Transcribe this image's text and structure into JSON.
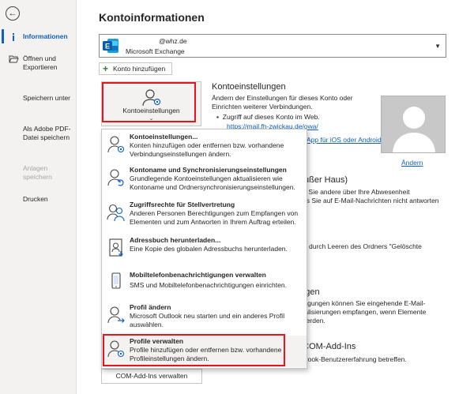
{
  "sidebar": {
    "back_icon": "arrow-left-icon",
    "items": [
      {
        "label": "Informationen",
        "icon": "info-icon"
      },
      {
        "label": "Öffnen und Exportieren",
        "icon": "folder-open-icon"
      },
      {
        "label": "Speichern unter"
      },
      {
        "label": "Als Adobe PDF-Datei speichern"
      },
      {
        "label": "Anlagen speichern"
      },
      {
        "label": "Drucken"
      }
    ]
  },
  "main": {
    "title": "Kontoinformationen",
    "account": {
      "email": "@whz.de",
      "type": "Microsoft Exchange"
    },
    "add_account_label": "Konto hinzufügen",
    "account_settings_button": "Kontoeinstellungen",
    "account_settings_section": {
      "title": "Kontoeinstellungen",
      "text": "Ändern der Einstellungen für dieses Konto oder Einrichten weiterer Verbindungen.",
      "bullet": "Zugriff auf dieses Konto im Web.",
      "link_partial": "https://mail.fh-zwickau.de/owa/",
      "app_link_partial": "App für iOS oder Android."
    },
    "change_photo_link": "Ändern",
    "ooo_title_partial": "(Außer Haus)",
    "ooo_text": [
      "nen Sie andere über Ihre Abwesenheit",
      "dass Sie auf E-Mail-Nachrichten nicht antworten"
    ],
    "cleanup_text": "ßen durch Leeren des Ordners \"Gelöschte",
    "rules_title_partial": "ungen",
    "rules_text": [
      "ichtigungen können Sie eingehende E-Mail-",
      "ktualisierungen empfangen, wenn Elemente",
      "rt werden."
    ],
    "com_title_partial": "e COM-Add-Ins",
    "com_text": "Outlook-Benutzererfahrung betreffen.",
    "com_button": "COM-Add-Ins verwalten"
  },
  "dropdown": {
    "items": [
      {
        "title": "Kontoeinstellungen...",
        "desc": "Konten hinzufügen oder entfernen bzw. vorhandene Verbindungseinstellungen ändern.",
        "icon": "account-settings-icon"
      },
      {
        "title": "Kontoname und Synchronisierungseinstellungen",
        "desc": "Grundlegende Kontoeinstellungen aktualisieren wie Kontoname und Ordnersynchronisierungseinstellungen.",
        "icon": "account-sync-icon"
      },
      {
        "title": "Zugriffsrechte für Stellvertretung",
        "desc": "Anderen Personen Berechtigungen zum Empfangen von Elementen und zum Antworten in Ihrem Auftrag erteilen.",
        "icon": "delegate-access-icon"
      },
      {
        "title": "Adressbuch herunterladen...",
        "desc": "Eine Kopie des globalen Adressbuchs herunterladen.",
        "icon": "address-book-icon"
      },
      {
        "title": "Mobiltelefonbenachrichtigungen verwalten",
        "desc": "SMS und Mobiltelefonbenachrichtigungen einrichten.",
        "icon": "mobile-notification-icon"
      },
      {
        "title": "Profil ändern",
        "desc": "Microsoft Outlook neu starten und ein anderes Profil auswählen.",
        "icon": "change-profile-icon"
      },
      {
        "title": "Profile verwalten",
        "desc": "Profile hinzufügen oder entfernen bzw. vorhandene Profileinstellungen ändern.",
        "icon": "manage-profiles-icon"
      }
    ]
  },
  "colors": {
    "accent": "#0f5fbd",
    "highlight_border": "#e8131c"
  }
}
